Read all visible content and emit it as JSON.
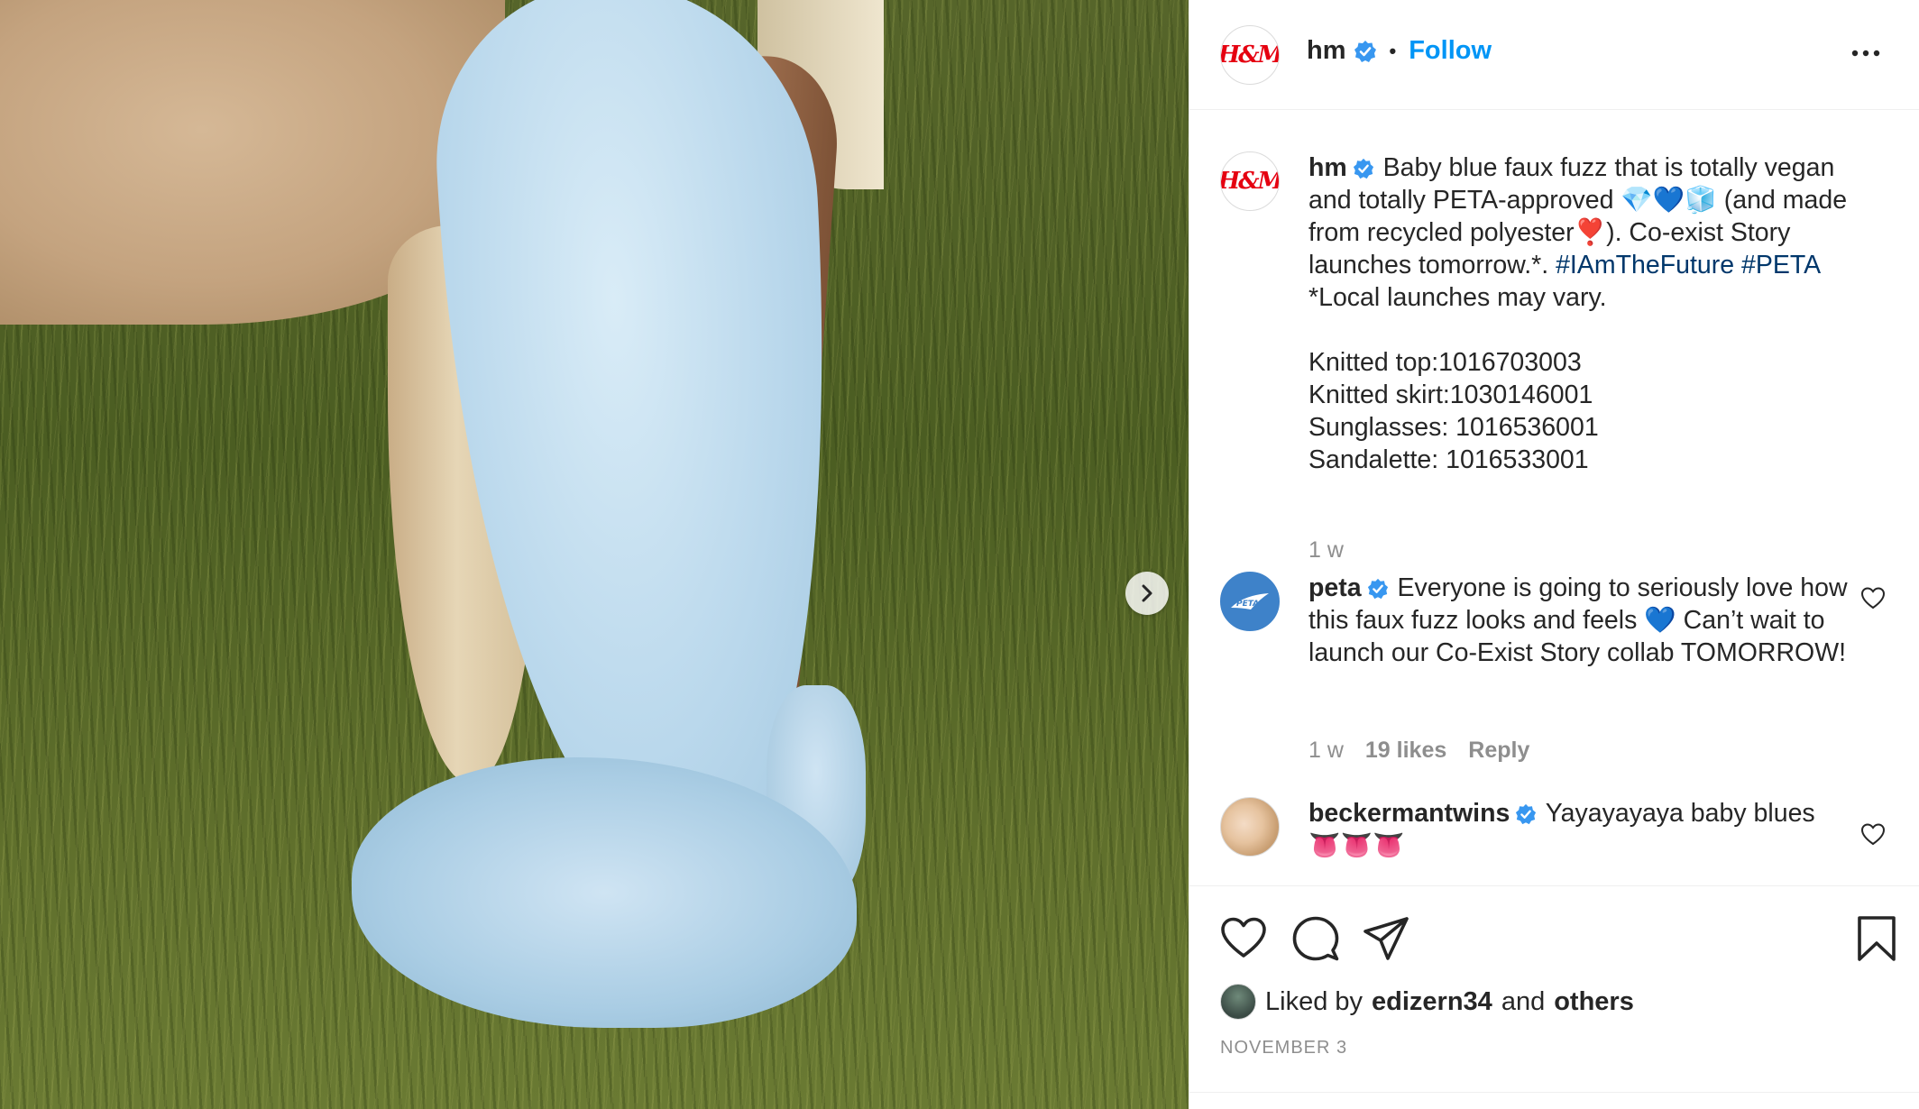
{
  "post": {
    "author": "hm",
    "follow_label": "Follow",
    "dot": "•",
    "logo_text": "H&M"
  },
  "caption": {
    "username": "hm",
    "text_part1": " Baby blue faux fuzz that is totally vegan and totally PETA-approved 💎💙🧊 (and made from recycled polyester❣️). Co-exist Story launches tomorrow.*. ",
    "hashtag1": "#IAmTheFuture",
    "hashtag2": "#PETA",
    "text_part2": "\n*Local launches may vary.\n\nKnitted top:1016703003\nKnitted skirt:1030146001\nSunglasses: 1016536001\nSandalette: 1016533001",
    "time": "1 w"
  },
  "comments": [
    {
      "username": "peta",
      "text": " Everyone is going to seriously love how this faux fuzz looks and feels 💙 Can’t wait to launch our Co-Exist Story collab TOMORROW!",
      "time": "1 w",
      "likes": "19 likes",
      "reply": "Reply",
      "avatar_text": "PETA"
    },
    {
      "username": "beckermantwins",
      "text": " Yayayayaya baby blues 👅👅👅"
    }
  ],
  "footer": {
    "liked_prefix": "Liked by",
    "liked_user": "edizern34",
    "liked_and": "and",
    "liked_others": "others",
    "date": "NOVEMBER 3"
  },
  "colors": {
    "accent": "#0095f6",
    "verified": "#3897f0",
    "brand_red": "#e50010",
    "hashtag": "#00376b",
    "muted": "#8e8e8e"
  },
  "icons": [
    "chevron-right-icon",
    "verified-icon",
    "more-icon",
    "heart-icon",
    "comment-icon",
    "share-icon",
    "bookmark-icon"
  ]
}
